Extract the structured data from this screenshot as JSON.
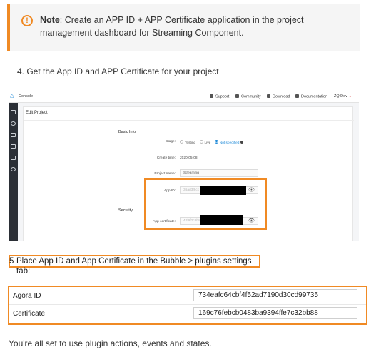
{
  "note": {
    "icon": "exclamation-icon",
    "bold_label": "Note",
    "text": ": Create an APP ID + APP Certificate  application in the project management dashboard for Streaming Component."
  },
  "step4": "4. Get the App ID and APP Certificate for your project",
  "console": {
    "brand": "Console",
    "nav": {
      "support": "Support",
      "community": "Community",
      "download": "Download",
      "documentation": "Documentation",
      "user": "ZQ Dev"
    },
    "page_title": "Edit Project",
    "basic_info": "Basic Info",
    "stage_label": "Stage:",
    "stage_options": [
      "Testing",
      "Live",
      "Not specified"
    ],
    "create_time_label": "Create time:",
    "create_time_value": "2020-05-08",
    "project_name_label": "Project name:",
    "project_name_value": "Streaming",
    "app_id_label": "App ID:",
    "app_id_partial": "36ad3f8cc",
    "security": "Security",
    "app_certificate_label": "App certificate:",
    "app_certificate_partial": "42f9f2c8b8"
  },
  "step5": {
    "number": "5",
    "text": "Place App ID and App Certificate in the Bubble  > plugins settings tab:"
  },
  "plugin_settings": [
    {
      "label": "Agora ID",
      "value": "734eafc64cbf4f52ad7190d30cd99735"
    },
    {
      "label": "Certificate",
      "value": "169c76febcb0483ba9394ffe7c32bb88"
    }
  ],
  "final_text": "You're all set to use plugin actions, events and states.",
  "colors": {
    "accent": "#f08a24",
    "link": "#1f8ad8",
    "sidebar": "#2b2f36"
  }
}
